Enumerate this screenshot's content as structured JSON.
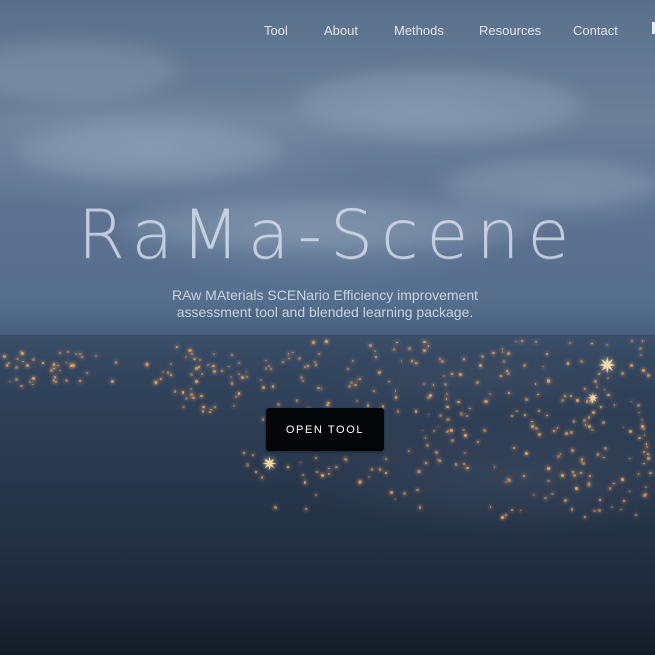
{
  "nav": {
    "brand_fragment": "e",
    "links": [
      {
        "label": "Tool"
      },
      {
        "label": "About"
      },
      {
        "label": "Methods"
      },
      {
        "label": "Resources"
      },
      {
        "label": "Contact"
      }
    ]
  },
  "hero": {
    "title": "RaMa-Scene",
    "subtitle": "RAw MAterials SCENario Efficiency improvement assessment tool and blended learning package.",
    "cta_label": "OPEN TOOL"
  },
  "colors": {
    "cta_background": "#050608",
    "nav_text": "#dfe6ee",
    "title_text": "#d6e0ec"
  }
}
